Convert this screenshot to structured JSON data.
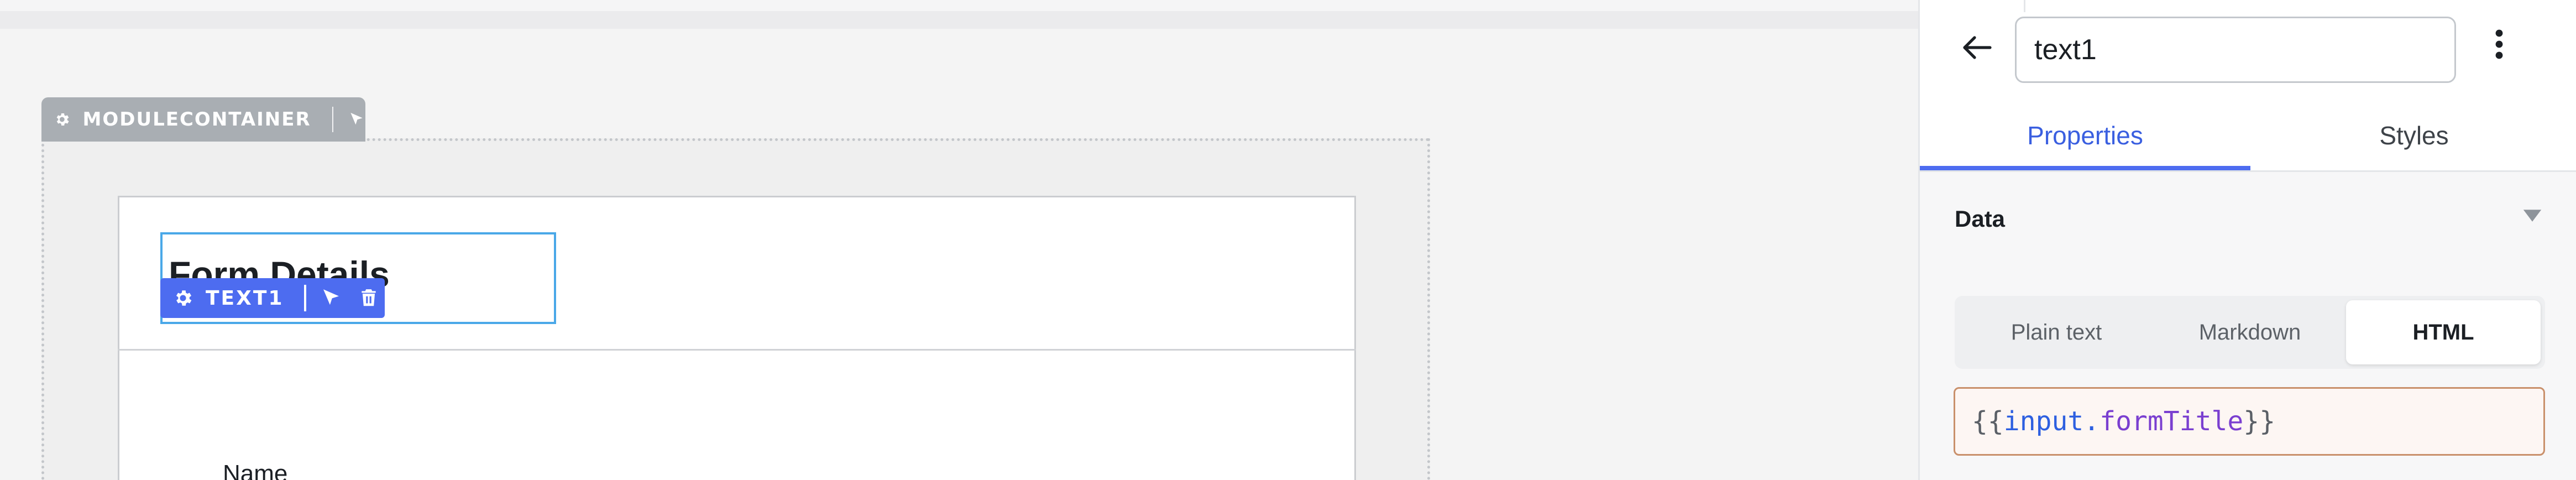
{
  "canvas": {
    "module_container_tag": {
      "label": "MODULECONTAINER",
      "icons": [
        "gear-icon",
        "pointer-icon"
      ]
    },
    "text1_tag": {
      "label": "TEXT1",
      "icons": [
        "gear-icon",
        "pointer-icon",
        "trash-icon"
      ]
    },
    "form_title": "Form Details",
    "name_label": "Name"
  },
  "inspector": {
    "back_icon": "arrow-left-icon",
    "component_name": "text1",
    "more_icon": "more-vertical-icon",
    "tabs": [
      {
        "label": "Properties",
        "active": true
      },
      {
        "label": "Styles",
        "active": false
      }
    ],
    "section": {
      "title": "Data",
      "caret_icon": "caret-down-icon"
    },
    "format_options": [
      {
        "label": "Plain text",
        "selected": false
      },
      {
        "label": "Markdown",
        "selected": false
      },
      {
        "label": "HTML",
        "selected": true
      }
    ],
    "value": {
      "open": "{{",
      "object": "input",
      "dot": ".",
      "property": "formTitle",
      "close": "}}"
    }
  },
  "colors": {
    "accent": "#4d6cf0",
    "selection_border": "#4aa8e8",
    "module_tag": "#a9aeb3",
    "code_field_border": "#c9906b"
  }
}
